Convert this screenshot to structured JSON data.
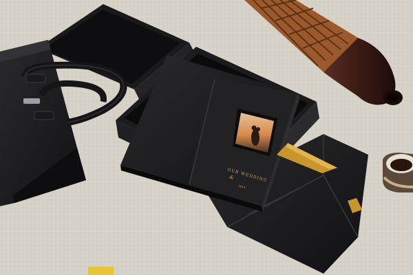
{
  "album": {
    "cover_text_line1": "OUR WEDDING",
    "cover_text_line2": "& ",
    "cover_text_line3": "2014"
  },
  "colors": {
    "background": "#d9d4c9",
    "leather": "#1c1c1e",
    "gold_ribbon": "#c9962b",
    "vase": "#3a1f1a"
  }
}
